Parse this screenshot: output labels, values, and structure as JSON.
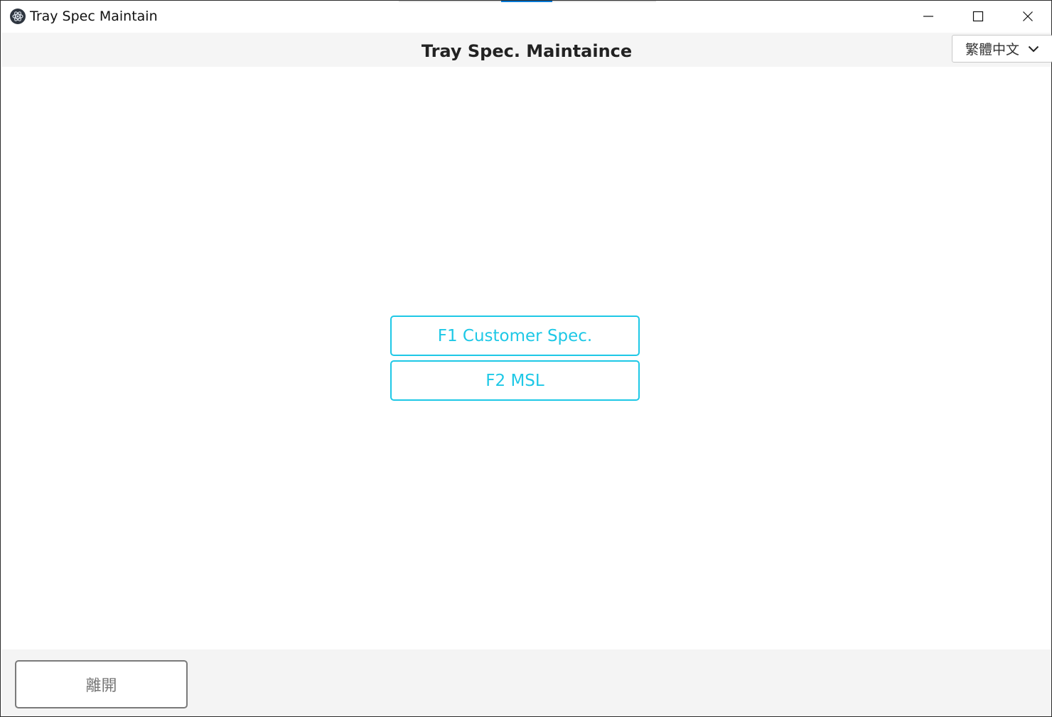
{
  "window": {
    "title": "Tray Spec Maintain",
    "controls": [
      "minimize-icon",
      "maximize-icon",
      "close-icon"
    ]
  },
  "header": {
    "title": "Tray Spec. Maintaince",
    "language": {
      "selected": "繁體中文",
      "icon": "chevron-down-icon"
    }
  },
  "main": {
    "buttons": [
      {
        "label": "F1 Customer Spec."
      },
      {
        "label": "F2 MSL"
      }
    ]
  },
  "footer": {
    "exit_label": "離開"
  },
  "colors": {
    "accent": "#1ec8e6",
    "header_bg": "#f5f5f5",
    "footer_bg": "#f4f4f4",
    "title_accent": "#0078d4"
  }
}
